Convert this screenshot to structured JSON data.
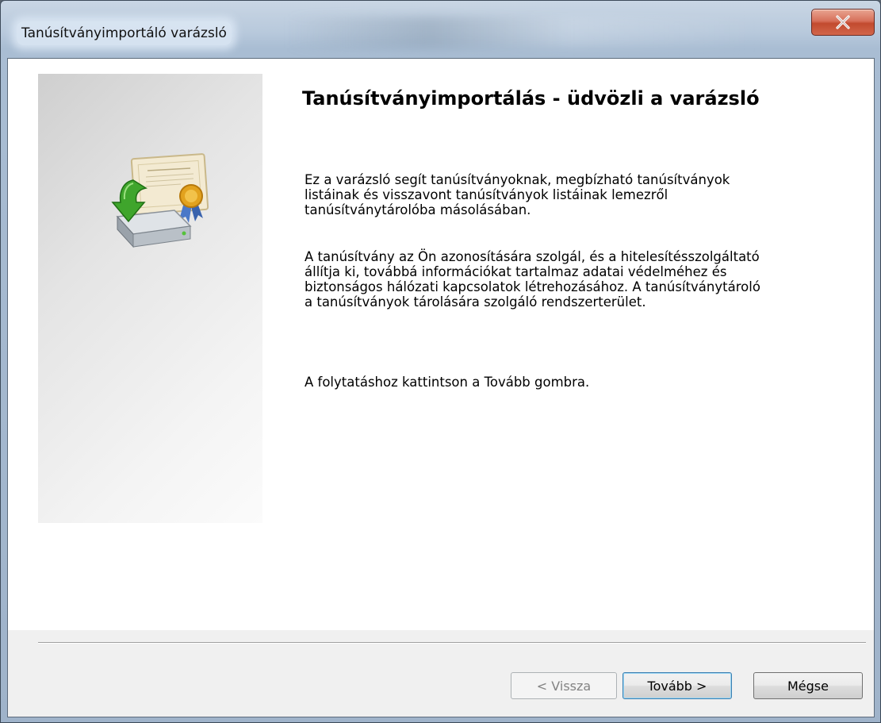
{
  "window": {
    "title": "Tanúsítványimportáló varázsló",
    "close_label": "x"
  },
  "icon": {
    "name": "certificate-import-icon",
    "colors": {
      "arrow": "#3fa52c",
      "seal": "#e2a21e",
      "drive": "#b9c0c7"
    }
  },
  "content": {
    "heading": "Tanúsítványimportálás - üdvözli a varázsló",
    "paragraph1": "Ez a varázsló segít tanúsítványoknak, megbízható tanúsítványok\nlistáinak és visszavont tanúsítványok listáinak lemezről\ntanúsítványtárolóba másolásában.",
    "paragraph2": "A tanúsítvány az Ön azonosítására szolgál, és a hitelesítésszolgáltató\nállítja ki, továbbá információkat tartalmaz adatai védelméhez és\nbiztonságos hálózati kapcsolatok létrehozásához. A tanúsítványtároló\na tanúsítványok tárolására szolgáló rendszerterület.",
    "paragraph3": "A folytatáshoz kattintson a Tovább gombra."
  },
  "buttons": {
    "back": "< Vissza",
    "next": "Tovább >",
    "cancel": "Mégse"
  }
}
